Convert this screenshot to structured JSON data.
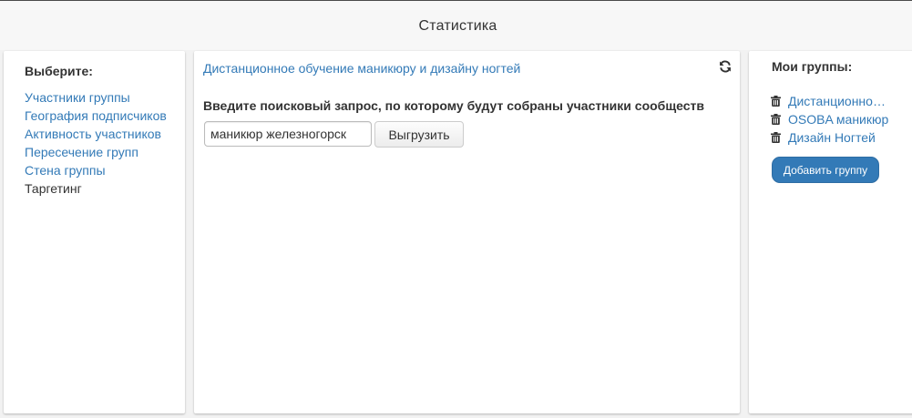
{
  "header": {
    "title": "Статистика"
  },
  "sidebar": {
    "title": "Выберите:",
    "items": [
      {
        "label": "Участники группы",
        "active": false
      },
      {
        "label": "География подписчиков",
        "active": false
      },
      {
        "label": "Активность участников",
        "active": false
      },
      {
        "label": "Пересечение групп",
        "active": false
      },
      {
        "label": "Стена группы",
        "active": false
      },
      {
        "label": "Таргетинг",
        "active": true
      }
    ]
  },
  "main": {
    "group_link": "Дистанционное обучение маникюру и дизайну ногтей",
    "refresh_icon": "refresh-icon",
    "prompt": "Введите поисковый запрос, по которому будут собраны участники сообществ",
    "search": {
      "value": "маникюр железногорск",
      "placeholder": ""
    },
    "export_label": "Выгрузить"
  },
  "groups_panel": {
    "title": "Мои группы:",
    "items": [
      {
        "label": "Дистанционное обучение маникюру и дизайну ногтей",
        "icon": "trash-icon"
      },
      {
        "label": "OSOBA маникюр",
        "icon": "trash-icon"
      },
      {
        "label": "Дизайн Ногтей",
        "icon": "trash-icon"
      }
    ],
    "add_label": "Добавить группу"
  },
  "colors": {
    "link": "#337ab7",
    "primary": "#337ab7",
    "background": "#f2f2f2",
    "text": "#333333"
  }
}
